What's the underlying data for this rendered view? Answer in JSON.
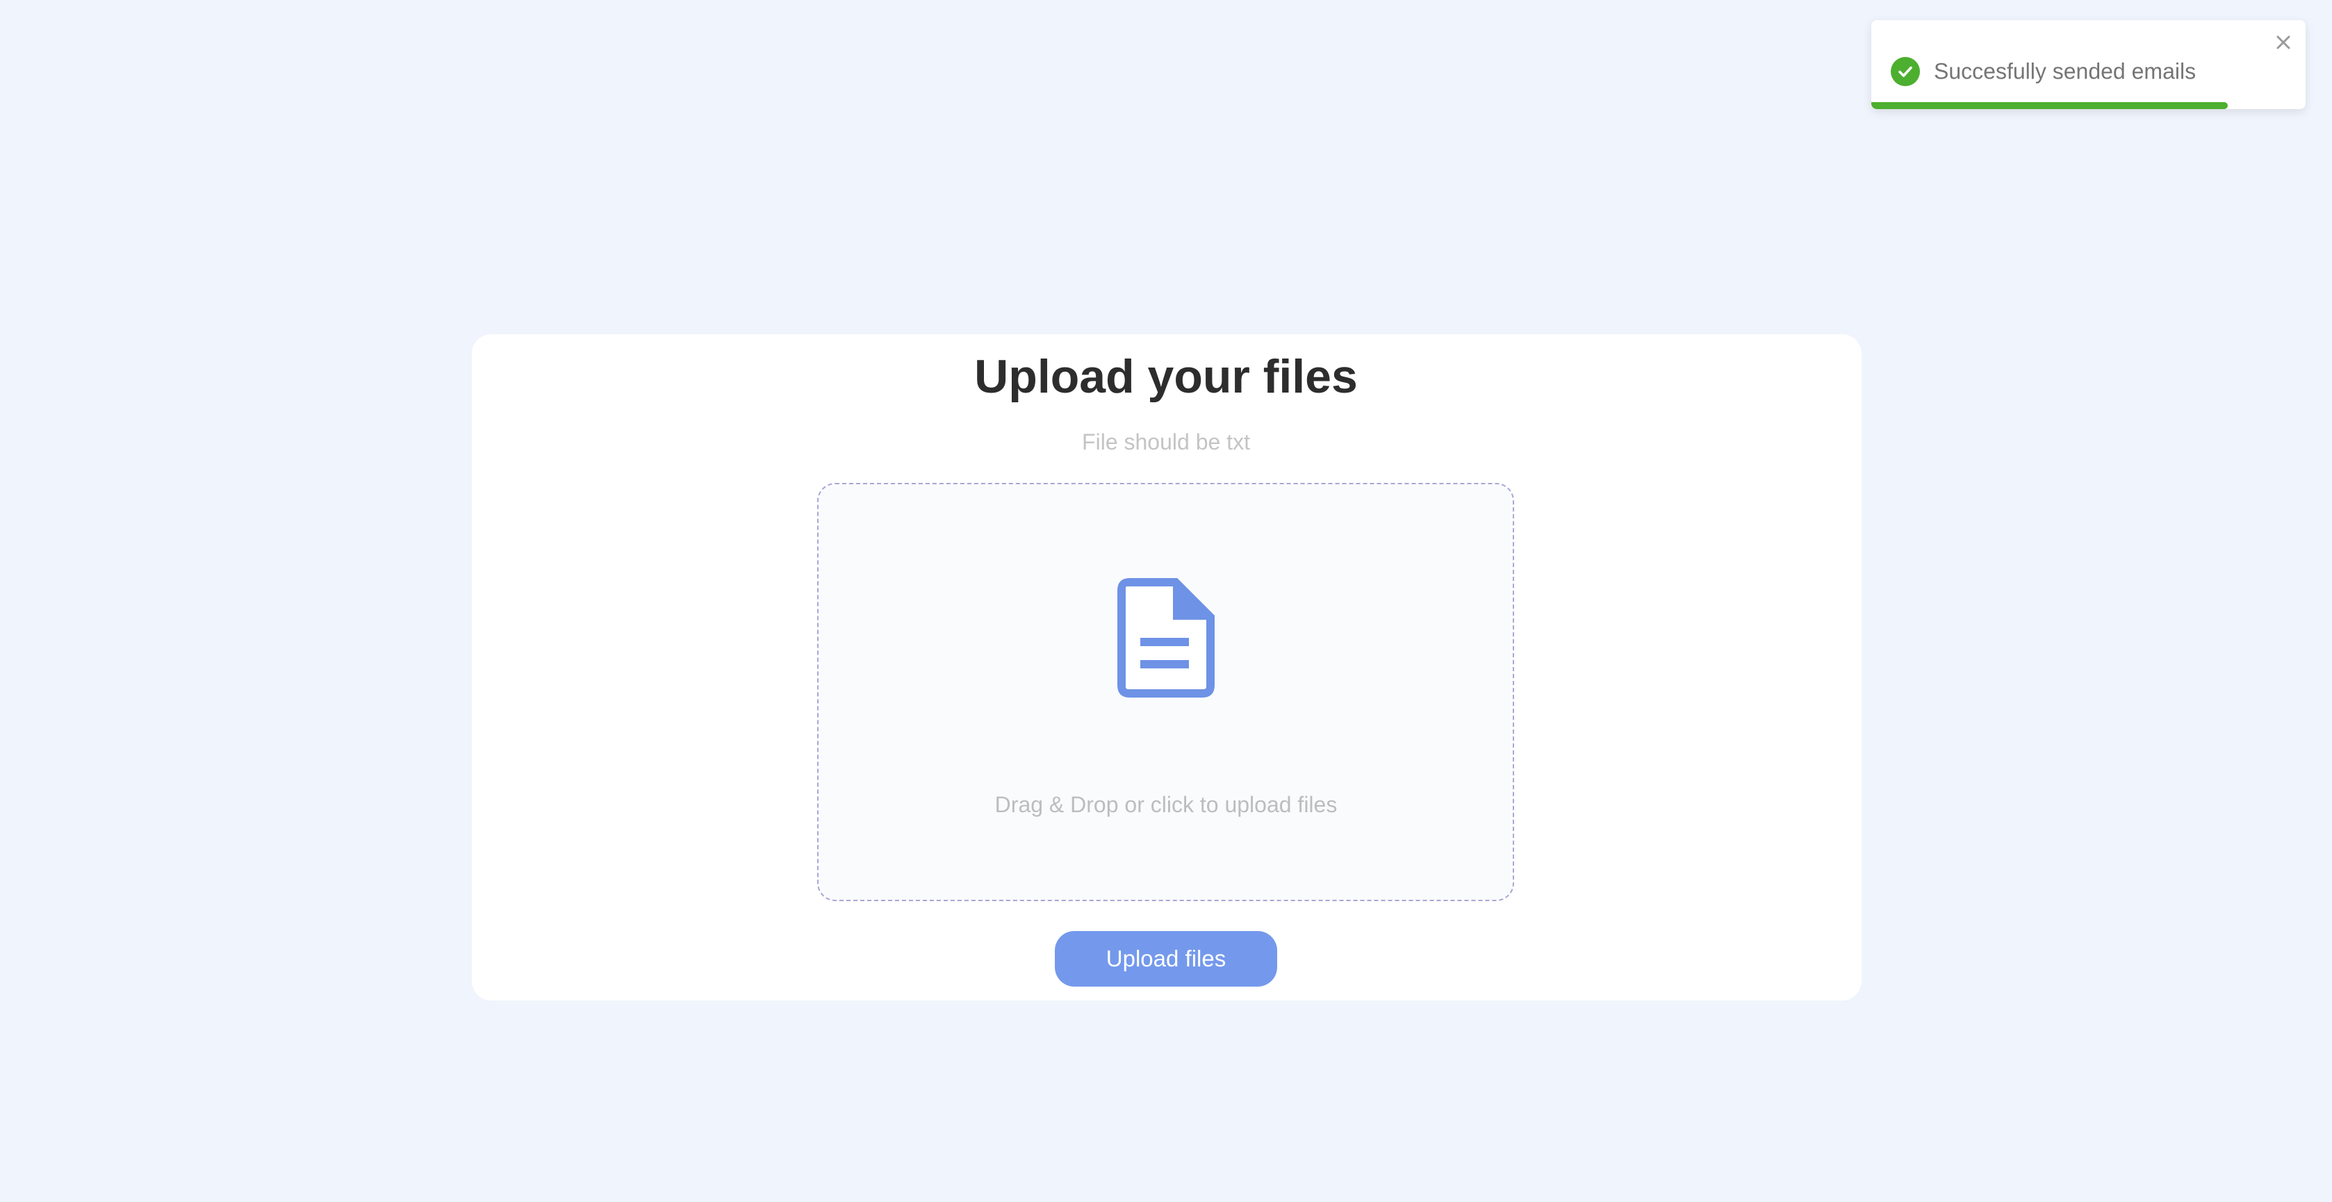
{
  "toast": {
    "message": "Succesfully sended emails",
    "status_icon": "check-circle-icon",
    "close_icon": "close-icon",
    "progress_fraction": 0.82,
    "color": "#4caf2f"
  },
  "upload": {
    "title": "Upload your files",
    "subtitle": "File should be txt",
    "dropzone_text": "Drag & Drop or click to upload files",
    "dropzone_icon": "file-document-icon",
    "button_label": "Upload files",
    "accent_color": "#7499ec"
  }
}
